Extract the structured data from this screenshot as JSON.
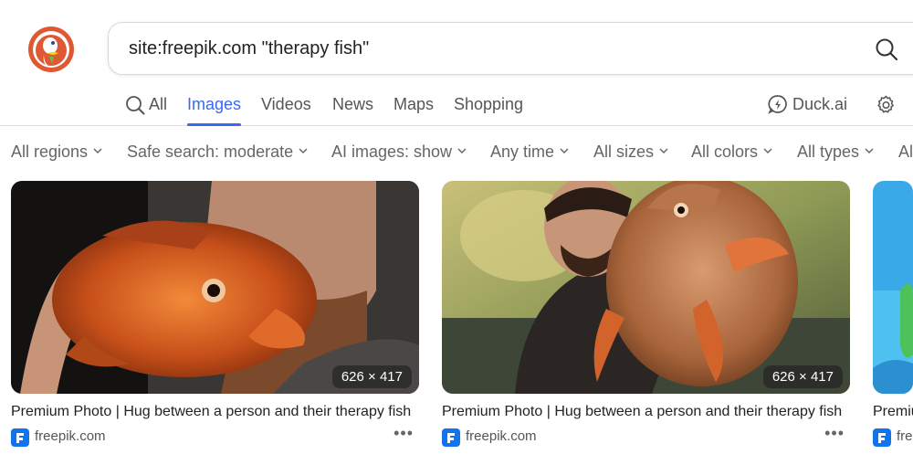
{
  "search": {
    "query": "site:freepik.com \"therapy fish\""
  },
  "tabs": [
    {
      "label": "All"
    },
    {
      "label": "Images"
    },
    {
      "label": "Videos"
    },
    {
      "label": "News"
    },
    {
      "label": "Maps"
    },
    {
      "label": "Shopping"
    }
  ],
  "header": {
    "duckai_label": "Duck.ai"
  },
  "filters": [
    {
      "label": "All regions"
    },
    {
      "label": "Safe search: moderate"
    },
    {
      "label": "AI images: show"
    },
    {
      "label": "Any time"
    },
    {
      "label": "All sizes"
    },
    {
      "label": "All colors"
    },
    {
      "label": "All types"
    },
    {
      "label": "Al"
    }
  ],
  "results": [
    {
      "dims": "626 × 417",
      "title": "Premium Photo | Hug between a person and their therapy fish",
      "source": "freepik.com"
    },
    {
      "dims": "626 × 417",
      "title": "Premium Photo | Hug between a person and their therapy fish",
      "source": "freepik.com"
    },
    {
      "title": "Premium",
      "source": "freepik.com"
    }
  ],
  "colors": {
    "accent": "#3969ef",
    "logo": "#de5833",
    "freepik": "#1273eb"
  }
}
